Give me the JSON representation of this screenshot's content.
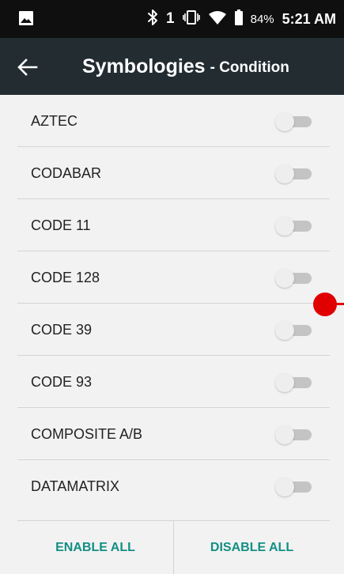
{
  "status_bar": {
    "bluetooth_icon": "bluetooth-icon",
    "sim_number": "1",
    "vibrate_icon": "vibrate-icon",
    "wifi_icon": "wifi-icon",
    "battery_icon": "battery-icon",
    "battery": "84%",
    "time": "5:21 AM",
    "image_icon": "image-notification-icon"
  },
  "app_bar": {
    "back_icon": "arrow-left-icon",
    "title": "Symbologies",
    "subtitle": "- Condition"
  },
  "list": {
    "items": [
      {
        "label": "AZTEC",
        "enabled": false
      },
      {
        "label": "CODABAR",
        "enabled": false
      },
      {
        "label": "CODE 11",
        "enabled": false
      },
      {
        "label": "CODE 128",
        "enabled": false
      },
      {
        "label": "CODE 39",
        "enabled": false
      },
      {
        "label": "CODE 93",
        "enabled": false
      },
      {
        "label": "COMPOSITE A/B",
        "enabled": false
      },
      {
        "label": "DATAMATRIX",
        "enabled": false
      }
    ]
  },
  "bottom": {
    "enable_all": "ENABLE ALL",
    "disable_all": "DISABLE ALL"
  },
  "colors": {
    "status_bar_bg": "#0f0f0f",
    "app_bar_bg": "#222c31",
    "accent": "#138f84",
    "list_bg": "#f2f2f2",
    "touch_indicator": "#e00000"
  }
}
